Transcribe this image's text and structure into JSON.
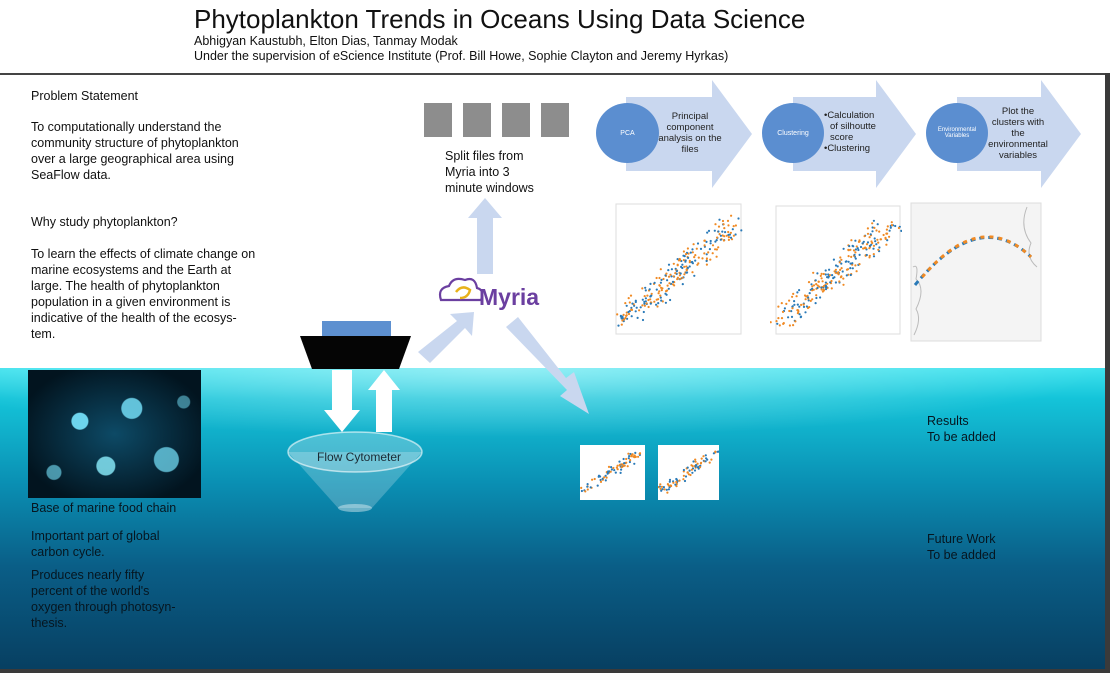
{
  "header": {
    "title": "Phytoplankton Trends in Oceans Using Data Science",
    "authors": "Abhigyan Kaustubh, Elton Dias, Tanmay Modak",
    "supervision": "Under the supervision of eScience Institute (Prof. Bill Howe, Sophie Clayton and Jeremy Hyrkas)"
  },
  "left": {
    "problem_heading": "Problem Statement",
    "problem_lines": [
      "To computationally understand the",
      "community structure of phytoplankton",
      "over a large geographical area using",
      "SeaFlow data."
    ],
    "why_heading": "Why study phytoplankton?",
    "why_lines": [
      "To learn the effects of climate change on",
      "marine ecosystems and the Earth at",
      "large. The health of phytoplankton",
      "population in a given environment is",
      "indicative of the health of the ecosys-",
      "tem."
    ],
    "caption_food": "Base of marine food chain",
    "carbon_lines": [
      "Important part of global",
      "carbon cycle."
    ],
    "oxygen_lines": [
      "Produces nearly fifty",
      "percent of the world's",
      "oxygen through photosyn-",
      "thesis."
    ]
  },
  "flow": {
    "split_lines": [
      "Split files from",
      "Myria into 3",
      "minute windows"
    ],
    "myria_logo": "Myria",
    "flow_cytometer": "Flow Cytometer"
  },
  "steps": [
    {
      "circle": "PCA",
      "text_lines": [
        "Principal",
        "component",
        "analysis on the",
        "files"
      ]
    },
    {
      "circle": "Clustering",
      "text_lines": [
        "•Calculation",
        "of silhoutte",
        "score",
        "•Clustering"
      ]
    },
    {
      "circle_lines": [
        "Environmental",
        "Variables"
      ],
      "text_lines": [
        "Plot the",
        "clusters with",
        "the",
        "environmental",
        "variables"
      ]
    }
  ],
  "results": {
    "heading": "Results",
    "value": "To be added"
  },
  "future": {
    "heading": "Future Work",
    "value": "To be added"
  },
  "colors": {
    "arrow": "#c9d7ef",
    "circle": "#5b8ed0",
    "series_blue": "#2a7ab8",
    "series_orange": "#f08a24"
  }
}
